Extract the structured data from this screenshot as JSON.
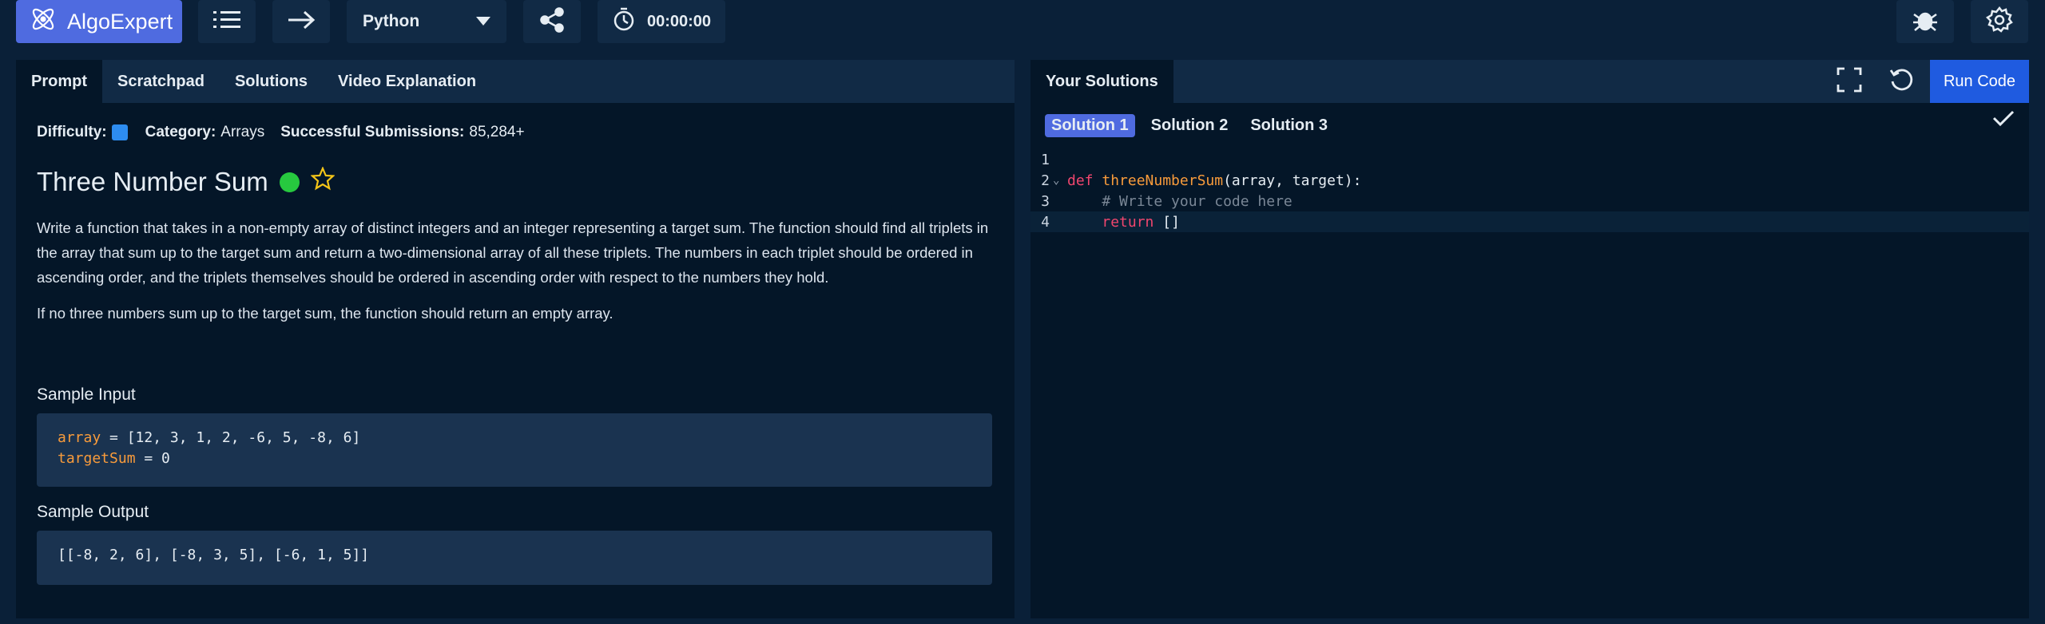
{
  "topbar": {
    "logo_label": "AlgoExpert",
    "language": "Python",
    "timer": "00:00:00"
  },
  "left": {
    "tabs": [
      "Prompt",
      "Scratchpad",
      "Solutions",
      "Video Explanation"
    ],
    "difficulty_label": "Difficulty:",
    "category_label": "Category:",
    "category_value": "Arrays",
    "submissions_label": "Successful Submissions:",
    "submissions_value": "85,284+",
    "title": "Three Number Sum",
    "description": [
      "Write a function that takes in a non-empty array of distinct integers and an integer representing a target sum. The function should find all triplets in the array that sum up to the target sum and return a two-dimensional array of all these triplets. The numbers in each triplet should be ordered in ascending order, and the triplets themselves should be ordered in ascending order with respect to the numbers they hold.",
      "If no three numbers sum up to the target sum, the function should return an empty array."
    ],
    "sample_input_heading": "Sample Input",
    "sample_input": {
      "line1_var": "array",
      "line1_rest": " = [12, 3, 1, 2, -6, 5, -8, 6]",
      "line2_var": "targetSum",
      "line2_rest": " = 0"
    },
    "sample_output_heading": "Sample Output",
    "sample_output": "[[-8, 2, 6], [-8, 3, 5], [-6, 1, 5]]"
  },
  "right": {
    "tab": "Your Solutions",
    "run_label": "Run Code",
    "solutions": [
      "Solution 1",
      "Solution 2",
      "Solution 3"
    ],
    "code": {
      "ln1": "1",
      "ln2": "2",
      "ln3": "3",
      "ln4": "4",
      "def": "def",
      "fn": "threeNumberSum",
      "sig": "(array, target):",
      "comment": "# Write your code here",
      "return_kw": "return",
      "return_val": " []"
    }
  },
  "colors": {
    "accent": "#4f6be0",
    "run_button": "#1f5be0",
    "difficulty": "#2d8cf0",
    "completed": "#27c93f"
  }
}
